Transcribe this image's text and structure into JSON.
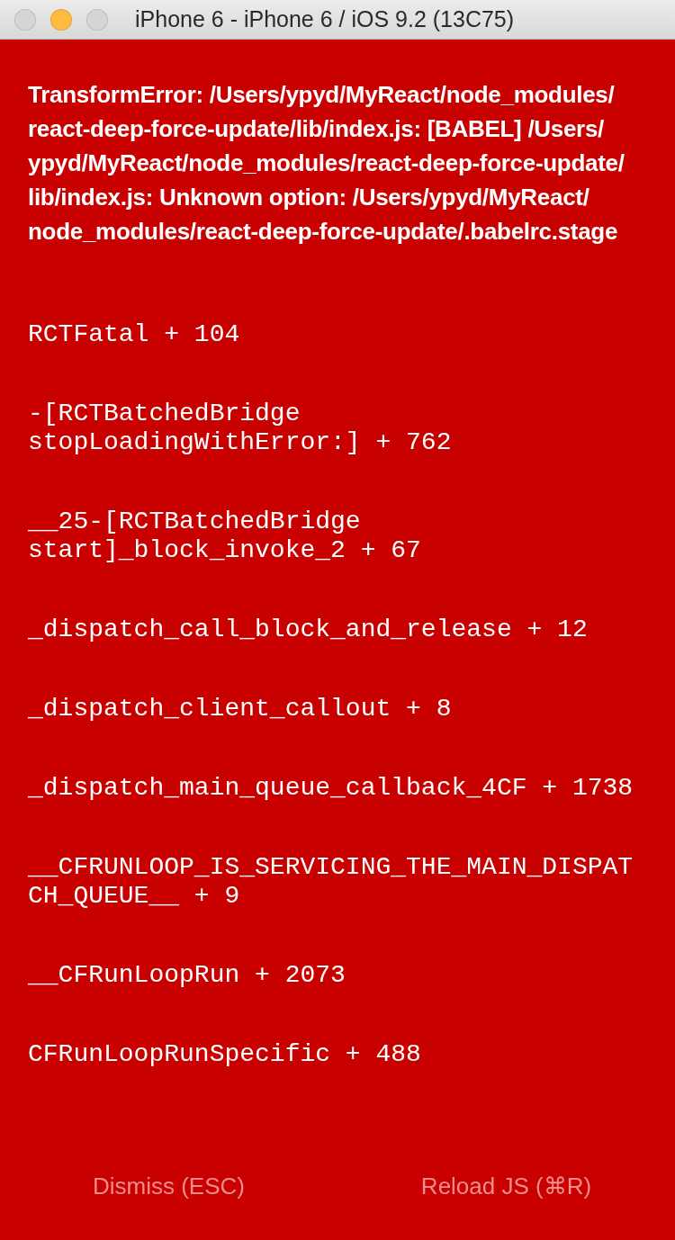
{
  "window": {
    "title": "iPhone 6 - iPhone 6 / iOS 9.2 (13C75)",
    "controls": [
      {
        "color": "#d6d6d6"
      },
      {
        "color": "#fdbc40"
      },
      {
        "color": "#d6d6d6"
      }
    ]
  },
  "error": {
    "message": "TransformError: /Users/ypyd/MyReact/node_modules/react-deep-force-update/lib/index.js: [BABEL] /Users/ypyd/MyReact/node_modules/react-deep-force-update/lib/index.js: Unknown option: /Users/ypyd/MyReact/node_modules/react-deep-force-update/.babelrc.stage",
    "stack": [
      "RCTFatal + 104",
      "-[RCTBatchedBridge stopLoadingWithError:] + 762",
      "__25-[RCTBatchedBridge start]_block_invoke_2 + 67",
      "_dispatch_call_block_and_release + 12",
      "_dispatch_client_callout + 8",
      "_dispatch_main_queue_callback_4CF + 1738",
      "__CFRUNLOOP_IS_SERVICING_THE_MAIN_DISPATCH_QUEUE__ + 9",
      "__CFRunLoopRun + 2073",
      "CFRunLoopRunSpecific + 488"
    ]
  },
  "buttons": [
    "Dismiss (ESC)",
    "Reload JS (⌘R)"
  ]
}
